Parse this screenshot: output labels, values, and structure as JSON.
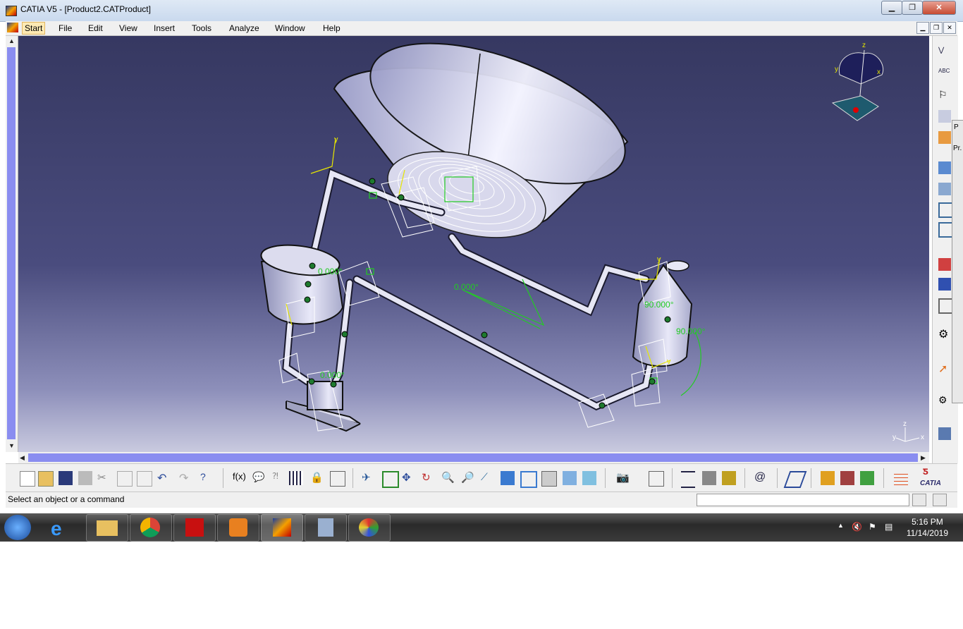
{
  "window": {
    "title": "CATIA V5 - [Product2.CATProduct]",
    "min_label": "▁",
    "max_label": "❐",
    "close_label": "✕"
  },
  "menu": {
    "items": [
      "Start",
      "File",
      "Edit",
      "View",
      "Insert",
      "Tools",
      "Analyze",
      "Window",
      "Help"
    ],
    "active": "Start"
  },
  "viewport": {
    "background_top": "#363861",
    "background_bottom": "#c9cadf",
    "annotations": {
      "angle_1": "0.000°",
      "angle_2": "0.000°",
      "angle_3": "90.000°",
      "angle_4": "0.000°",
      "angle_5": "90.000°"
    },
    "compass_axes": {
      "z": "z",
      "x": "x",
      "y": "y"
    },
    "axis_small": {
      "z": "z",
      "x": "x",
      "y": "y"
    }
  },
  "right_toolbar_icons": [
    "tree-icon",
    "abc-text-icon",
    "flag-note-icon",
    "part-icon",
    "assembly-icon",
    "box-icon",
    "cube-icon",
    "component-icon",
    "component2-icon",
    "move-icon",
    "rotate-icon",
    "snap-icon",
    "gear-icon",
    "cursor-icon",
    "link-icon",
    "analyze-icon"
  ],
  "bottom_toolbar_icons": [
    "new-icon",
    "open-icon",
    "save-icon",
    "print-icon",
    "cut-icon",
    "copy-icon",
    "paste-icon",
    "undo-icon",
    "redo-icon",
    "whats-this-icon",
    "formula-icon",
    "comment-icon",
    "knowledge-icon",
    "table-icon",
    "lock-icon",
    "compute-icon",
    "fly-icon",
    "fit-all-icon",
    "pan-icon",
    "rotate-view-icon",
    "zoom-in-icon",
    "zoom-out-icon",
    "normal-view-icon",
    "multi-view-icon",
    "iso-view-icon",
    "shading-icon",
    "hide-show-icon",
    "swap-icon",
    "camera-icon",
    "catalog-icon",
    "measure-icon",
    "inertia-icon",
    "bottle-icon",
    "spiral-icon",
    "plane-icon",
    "render-icon",
    "material-icon",
    "scene-icon",
    "grid-icon"
  ],
  "right_panel": {
    "label_1": "P",
    "label_2": "Pr."
  },
  "status": {
    "message": "Select an object or a command",
    "field_value": ""
  },
  "taskbar": {
    "time": "5:16 PM",
    "date": "11/14/2019",
    "apps": [
      "explorer",
      "chrome",
      "acrobat",
      "media-player",
      "catia",
      "calculator",
      "paint"
    ]
  },
  "logo": "CATIA"
}
